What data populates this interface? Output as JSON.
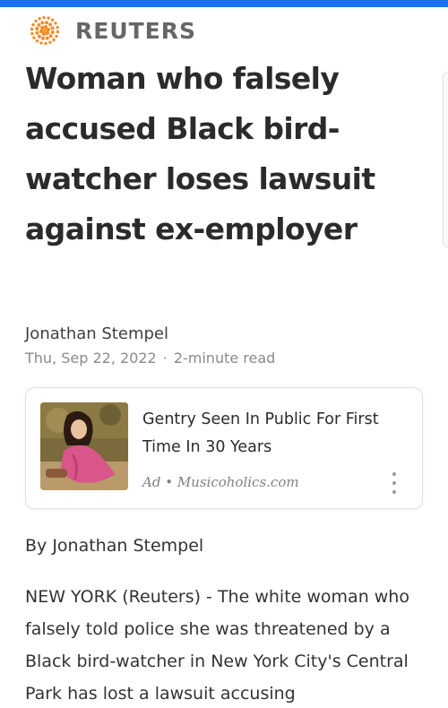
{
  "brand": {
    "name": "REUTERS",
    "logo_icon": "reuters-dot-logo",
    "accent": "#f28c28"
  },
  "article": {
    "headline": "Woman who falsely accused Black bird-watcher loses lawsuit against ex-employer",
    "author": "Jonathan Stempel",
    "date": "Thu, Sep 22, 2022",
    "separator": "·",
    "read_time": "2-minute read",
    "byline": "By Jonathan Stempel",
    "body": "NEW YORK (Reuters) - The white woman who falsely told police she was threatened by a Black bird-watcher in New York City's Central Park has lost a lawsuit accusing"
  },
  "ad": {
    "title": "Gentry Seen In Public For First Time In 30 Years",
    "source": "Ad • Musicoholics.com",
    "more_icon": "more-vertical-icon"
  },
  "colors": {
    "top_bar": "#1a73e8",
    "headline": "#2b2b2b",
    "meta": "#8a8a8a"
  }
}
